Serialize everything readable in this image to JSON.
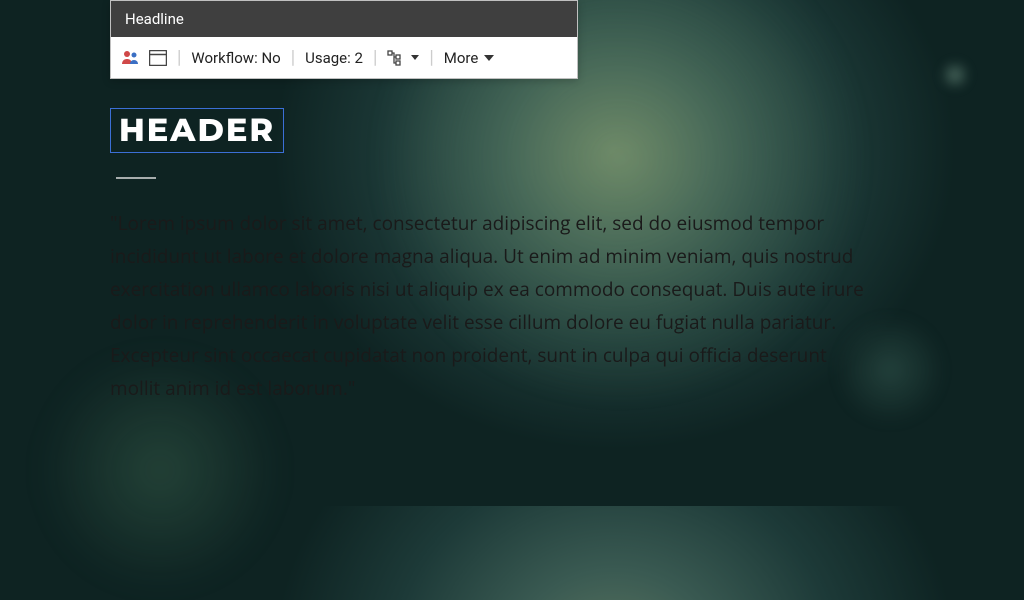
{
  "panel": {
    "title": "Headline",
    "workflow_label": "Workflow:",
    "workflow_value": "No",
    "usage_label": "Usage:",
    "usage_value": "2",
    "more_label": "More"
  },
  "content": {
    "header": "HEADER",
    "body": "\"Lorem ipsum dolor sit amet, consectetur adipiscing elit, sed do eiusmod tempor incididunt ut labore et dolore magna aliqua. Ut enim ad minim veniam, quis nostrud exercitation ullamco laboris nisi ut aliquip ex ea commodo consequat. Duis aute irure dolor in reprehenderit in voluptate velit esse cillum dolore eu fugiat nulla pariatur. Excepteur sint occaecat cupidatat non proident, sunt in culpa qui officia deserunt mollit anim id est laborum.\""
  },
  "colors": {
    "panel_header_bg": "#3f3f3f",
    "selection_border": "#3b6fd6"
  }
}
